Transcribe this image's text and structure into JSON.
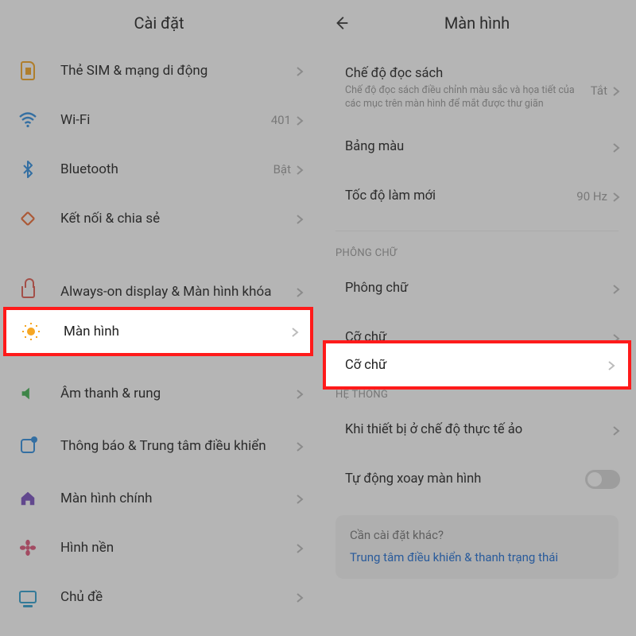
{
  "left": {
    "title": "Cài đặt",
    "items": {
      "sim": "Thẻ SIM & mạng di động",
      "wifi": "Wi-Fi",
      "wifi_val": "401",
      "bt": "Bluetooth",
      "bt_val": "Bật",
      "share": "Kết nối & chia sẻ",
      "aod": "Always-on display & Màn hình khóa",
      "display": "Màn hình",
      "sound": "Âm thanh & rung",
      "notif": "Thông báo & Trung tâm điều khiển",
      "home": "Màn hình chính",
      "wall": "Hình nền",
      "theme": "Chủ đề"
    }
  },
  "right": {
    "title": "Màn hình",
    "read_mode": "Chế độ đọc sách",
    "read_mode_sub": "Chế độ đọc sách điều chỉnh màu sắc và họa tiết của các mục trên màn hình để mắt được thư giãn",
    "read_mode_val": "Tắt",
    "palette": "Bảng màu",
    "refresh": "Tốc độ làm mới",
    "refresh_val": "90 Hz",
    "sec_font": "PHÔNG CHỮ",
    "font": "Phông chữ",
    "font_size": "Cỡ chữ",
    "sec_sys": "HỆ THỐNG",
    "vr": "Khi thiết bị ở chế độ thực tế ảo",
    "rotate": "Tự động xoay màn hình",
    "card_title": "Cần cài đặt khác?",
    "card_link": "Trung tâm điều khiển & thanh trạng thái"
  }
}
